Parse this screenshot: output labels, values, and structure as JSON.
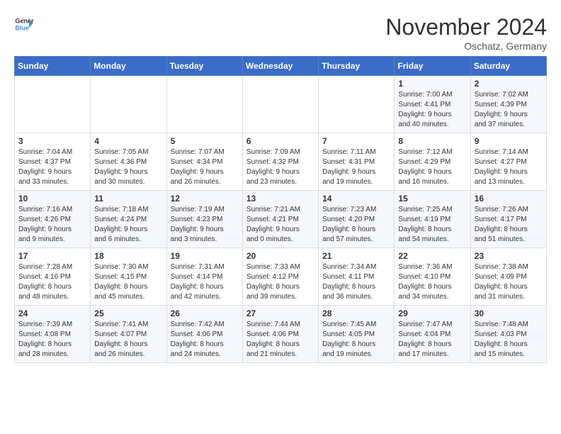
{
  "logo": {
    "line1": "General",
    "line2": "Blue"
  },
  "title": "November 2024",
  "location": "Oschatz, Germany",
  "days_of_week": [
    "Sunday",
    "Monday",
    "Tuesday",
    "Wednesday",
    "Thursday",
    "Friday",
    "Saturday"
  ],
  "weeks": [
    [
      {
        "day": "",
        "detail": ""
      },
      {
        "day": "",
        "detail": ""
      },
      {
        "day": "",
        "detail": ""
      },
      {
        "day": "",
        "detail": ""
      },
      {
        "day": "",
        "detail": ""
      },
      {
        "day": "1",
        "detail": "Sunrise: 7:00 AM\nSunset: 4:41 PM\nDaylight: 9 hours\nand 40 minutes."
      },
      {
        "day": "2",
        "detail": "Sunrise: 7:02 AM\nSunset: 4:39 PM\nDaylight: 9 hours\nand 37 minutes."
      }
    ],
    [
      {
        "day": "3",
        "detail": "Sunrise: 7:04 AM\nSunset: 4:37 PM\nDaylight: 9 hours\nand 33 minutes."
      },
      {
        "day": "4",
        "detail": "Sunrise: 7:05 AM\nSunset: 4:36 PM\nDaylight: 9 hours\nand 30 minutes."
      },
      {
        "day": "5",
        "detail": "Sunrise: 7:07 AM\nSunset: 4:34 PM\nDaylight: 9 hours\nand 26 minutes."
      },
      {
        "day": "6",
        "detail": "Sunrise: 7:09 AM\nSunset: 4:32 PM\nDaylight: 9 hours\nand 23 minutes."
      },
      {
        "day": "7",
        "detail": "Sunrise: 7:11 AM\nSunset: 4:31 PM\nDaylight: 9 hours\nand 19 minutes."
      },
      {
        "day": "8",
        "detail": "Sunrise: 7:12 AM\nSunset: 4:29 PM\nDaylight: 9 hours\nand 16 minutes."
      },
      {
        "day": "9",
        "detail": "Sunrise: 7:14 AM\nSunset: 4:27 PM\nDaylight: 9 hours\nand 13 minutes."
      }
    ],
    [
      {
        "day": "10",
        "detail": "Sunrise: 7:16 AM\nSunset: 4:26 PM\nDaylight: 9 hours\nand 9 minutes."
      },
      {
        "day": "11",
        "detail": "Sunrise: 7:18 AM\nSunset: 4:24 PM\nDaylight: 9 hours\nand 6 minutes."
      },
      {
        "day": "12",
        "detail": "Sunrise: 7:19 AM\nSunset: 4:23 PM\nDaylight: 9 hours\nand 3 minutes."
      },
      {
        "day": "13",
        "detail": "Sunrise: 7:21 AM\nSunset: 4:21 PM\nDaylight: 9 hours\nand 0 minutes."
      },
      {
        "day": "14",
        "detail": "Sunrise: 7:23 AM\nSunset: 4:20 PM\nDaylight: 8 hours\nand 57 minutes."
      },
      {
        "day": "15",
        "detail": "Sunrise: 7:25 AM\nSunset: 4:19 PM\nDaylight: 8 hours\nand 54 minutes."
      },
      {
        "day": "16",
        "detail": "Sunrise: 7:26 AM\nSunset: 4:17 PM\nDaylight: 8 hours\nand 51 minutes."
      }
    ],
    [
      {
        "day": "17",
        "detail": "Sunrise: 7:28 AM\nSunset: 4:16 PM\nDaylight: 8 hours\nand 48 minutes."
      },
      {
        "day": "18",
        "detail": "Sunrise: 7:30 AM\nSunset: 4:15 PM\nDaylight: 8 hours\nand 45 minutes."
      },
      {
        "day": "19",
        "detail": "Sunrise: 7:31 AM\nSunset: 4:14 PM\nDaylight: 8 hours\nand 42 minutes."
      },
      {
        "day": "20",
        "detail": "Sunrise: 7:33 AM\nSunset: 4:12 PM\nDaylight: 8 hours\nand 39 minutes."
      },
      {
        "day": "21",
        "detail": "Sunrise: 7:34 AM\nSunset: 4:11 PM\nDaylight: 8 hours\nand 36 minutes."
      },
      {
        "day": "22",
        "detail": "Sunrise: 7:36 AM\nSunset: 4:10 PM\nDaylight: 8 hours\nand 34 minutes."
      },
      {
        "day": "23",
        "detail": "Sunrise: 7:38 AM\nSunset: 4:09 PM\nDaylight: 8 hours\nand 31 minutes."
      }
    ],
    [
      {
        "day": "24",
        "detail": "Sunrise: 7:39 AM\nSunset: 4:08 PM\nDaylight: 8 hours\nand 28 minutes."
      },
      {
        "day": "25",
        "detail": "Sunrise: 7:41 AM\nSunset: 4:07 PM\nDaylight: 8 hours\nand 26 minutes."
      },
      {
        "day": "26",
        "detail": "Sunrise: 7:42 AM\nSunset: 4:06 PM\nDaylight: 8 hours\nand 24 minutes."
      },
      {
        "day": "27",
        "detail": "Sunrise: 7:44 AM\nSunset: 4:06 PM\nDaylight: 8 hours\nand 21 minutes."
      },
      {
        "day": "28",
        "detail": "Sunrise: 7:45 AM\nSunset: 4:05 PM\nDaylight: 8 hours\nand 19 minutes."
      },
      {
        "day": "29",
        "detail": "Sunrise: 7:47 AM\nSunset: 4:04 PM\nDaylight: 8 hours\nand 17 minutes."
      },
      {
        "day": "30",
        "detail": "Sunrise: 7:48 AM\nSunset: 4:03 PM\nDaylight: 8 hours\nand 15 minutes."
      }
    ]
  ]
}
